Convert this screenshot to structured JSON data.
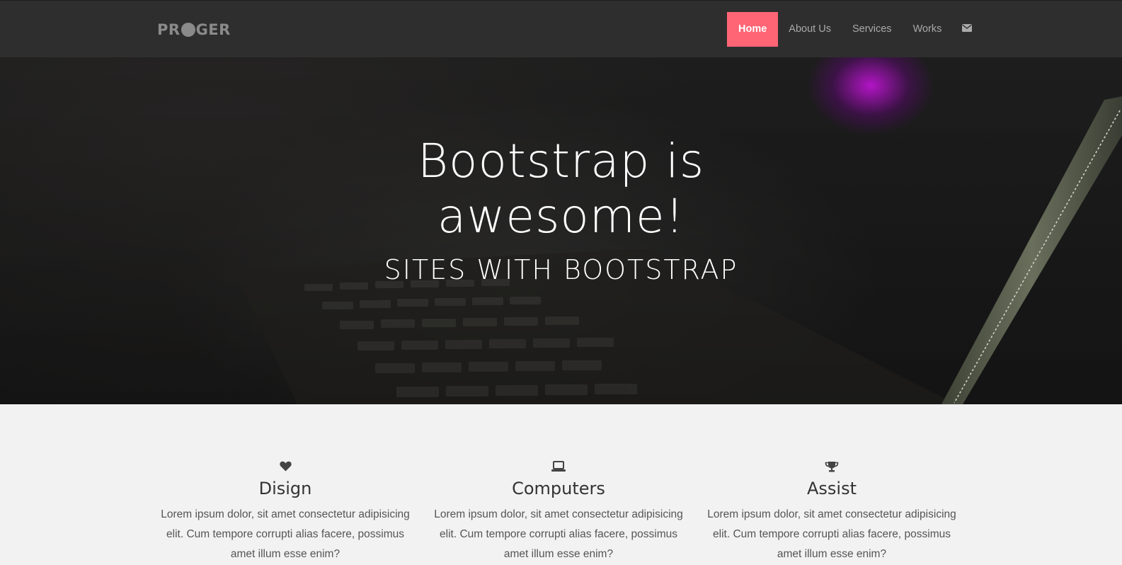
{
  "brand": {
    "text_before": "PR",
    "text_after": "GER"
  },
  "nav": {
    "items": [
      {
        "label": "Home",
        "active": true
      },
      {
        "label": "About Us"
      },
      {
        "label": "Services"
      },
      {
        "label": "Works"
      }
    ],
    "mail_icon": "envelope-icon"
  },
  "hero": {
    "title_line1": "Bootstrap is",
    "title_line2": "awesome!",
    "subtitle": "SITES WITH BOOTSTRAP"
  },
  "features": [
    {
      "icon": "heart-icon",
      "title": "Disign",
      "text": "Lorem ipsum dolor, sit amet consectetur adipisicing elit. Cum tempore corrupti alias facere, possimus amet illum esse enim?"
    },
    {
      "icon": "laptop-icon",
      "title": "Computers",
      "text": "Lorem ipsum dolor, sit amet consectetur adipisicing elit. Cum tempore corrupti alias facere, possimus amet illum esse enim?"
    },
    {
      "icon": "trophy-icon",
      "title": "Assist",
      "text": "Lorem ipsum dolor, sit amet consectetur adipisicing elit. Cum tempore corrupti alias facere, possimus amet illum esse enim?"
    }
  ],
  "colors": {
    "accent": "#ff6575",
    "navbar_bg": "#2e2e2e",
    "nav_text": "#a9a9a9",
    "section_bg": "#f2f2f2"
  }
}
